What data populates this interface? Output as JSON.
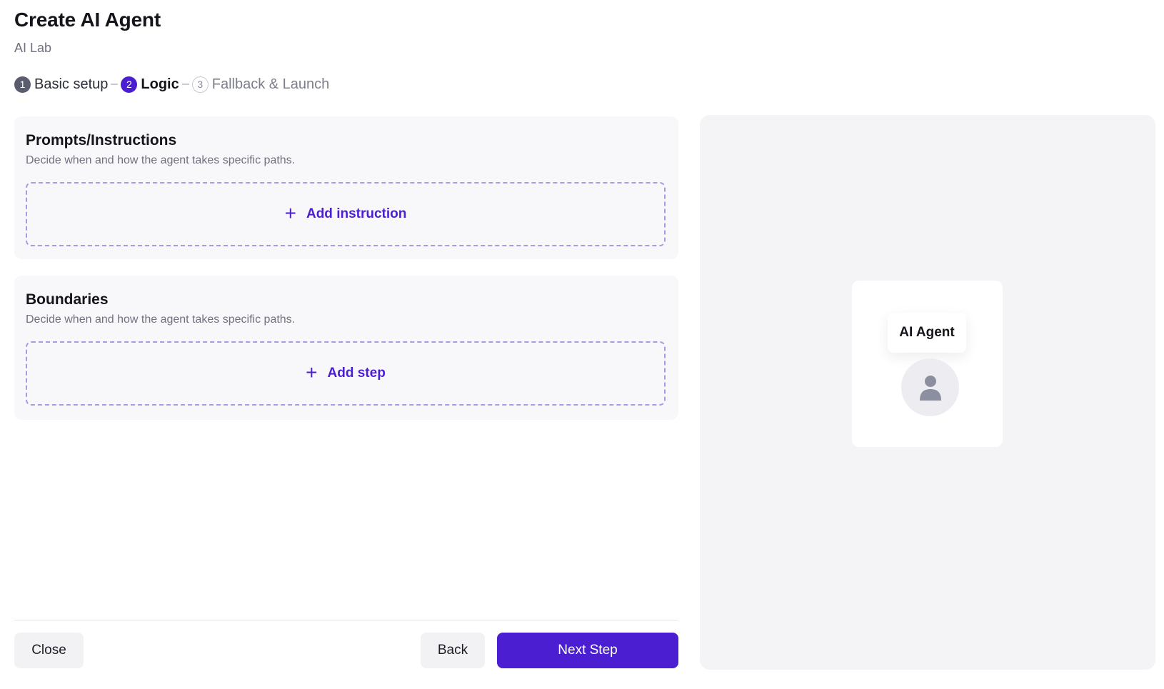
{
  "header": {
    "title": "Create AI Agent",
    "subtitle": "AI Lab"
  },
  "stepper": {
    "steps": [
      {
        "number": "1",
        "label": "Basic setup",
        "state": "done"
      },
      {
        "number": "2",
        "label": "Logic",
        "state": "active"
      },
      {
        "number": "3",
        "label": "Fallback & Launch",
        "state": "todo"
      }
    ]
  },
  "sections": {
    "prompts": {
      "title": "Prompts/Instructions",
      "description": "Decide when and how the agent takes specific paths.",
      "button_label": "Add instruction",
      "button_icon": "plus-icon"
    },
    "boundaries": {
      "title": "Boundaries",
      "description": "Decide when and how the agent takes specific paths.",
      "button_label": "Add step",
      "button_icon": "plus-icon"
    }
  },
  "footer": {
    "close_label": "Close",
    "back_label": "Back",
    "next_label": "Next Step"
  },
  "preview": {
    "agent_name": "AI Agent",
    "avatar_icon": "user-icon"
  },
  "colors": {
    "accent": "#4b1fd1",
    "dashed_border": "#a99ae6",
    "panel_bg": "#f4f4f7",
    "card_bg": "#f8f8fb"
  }
}
